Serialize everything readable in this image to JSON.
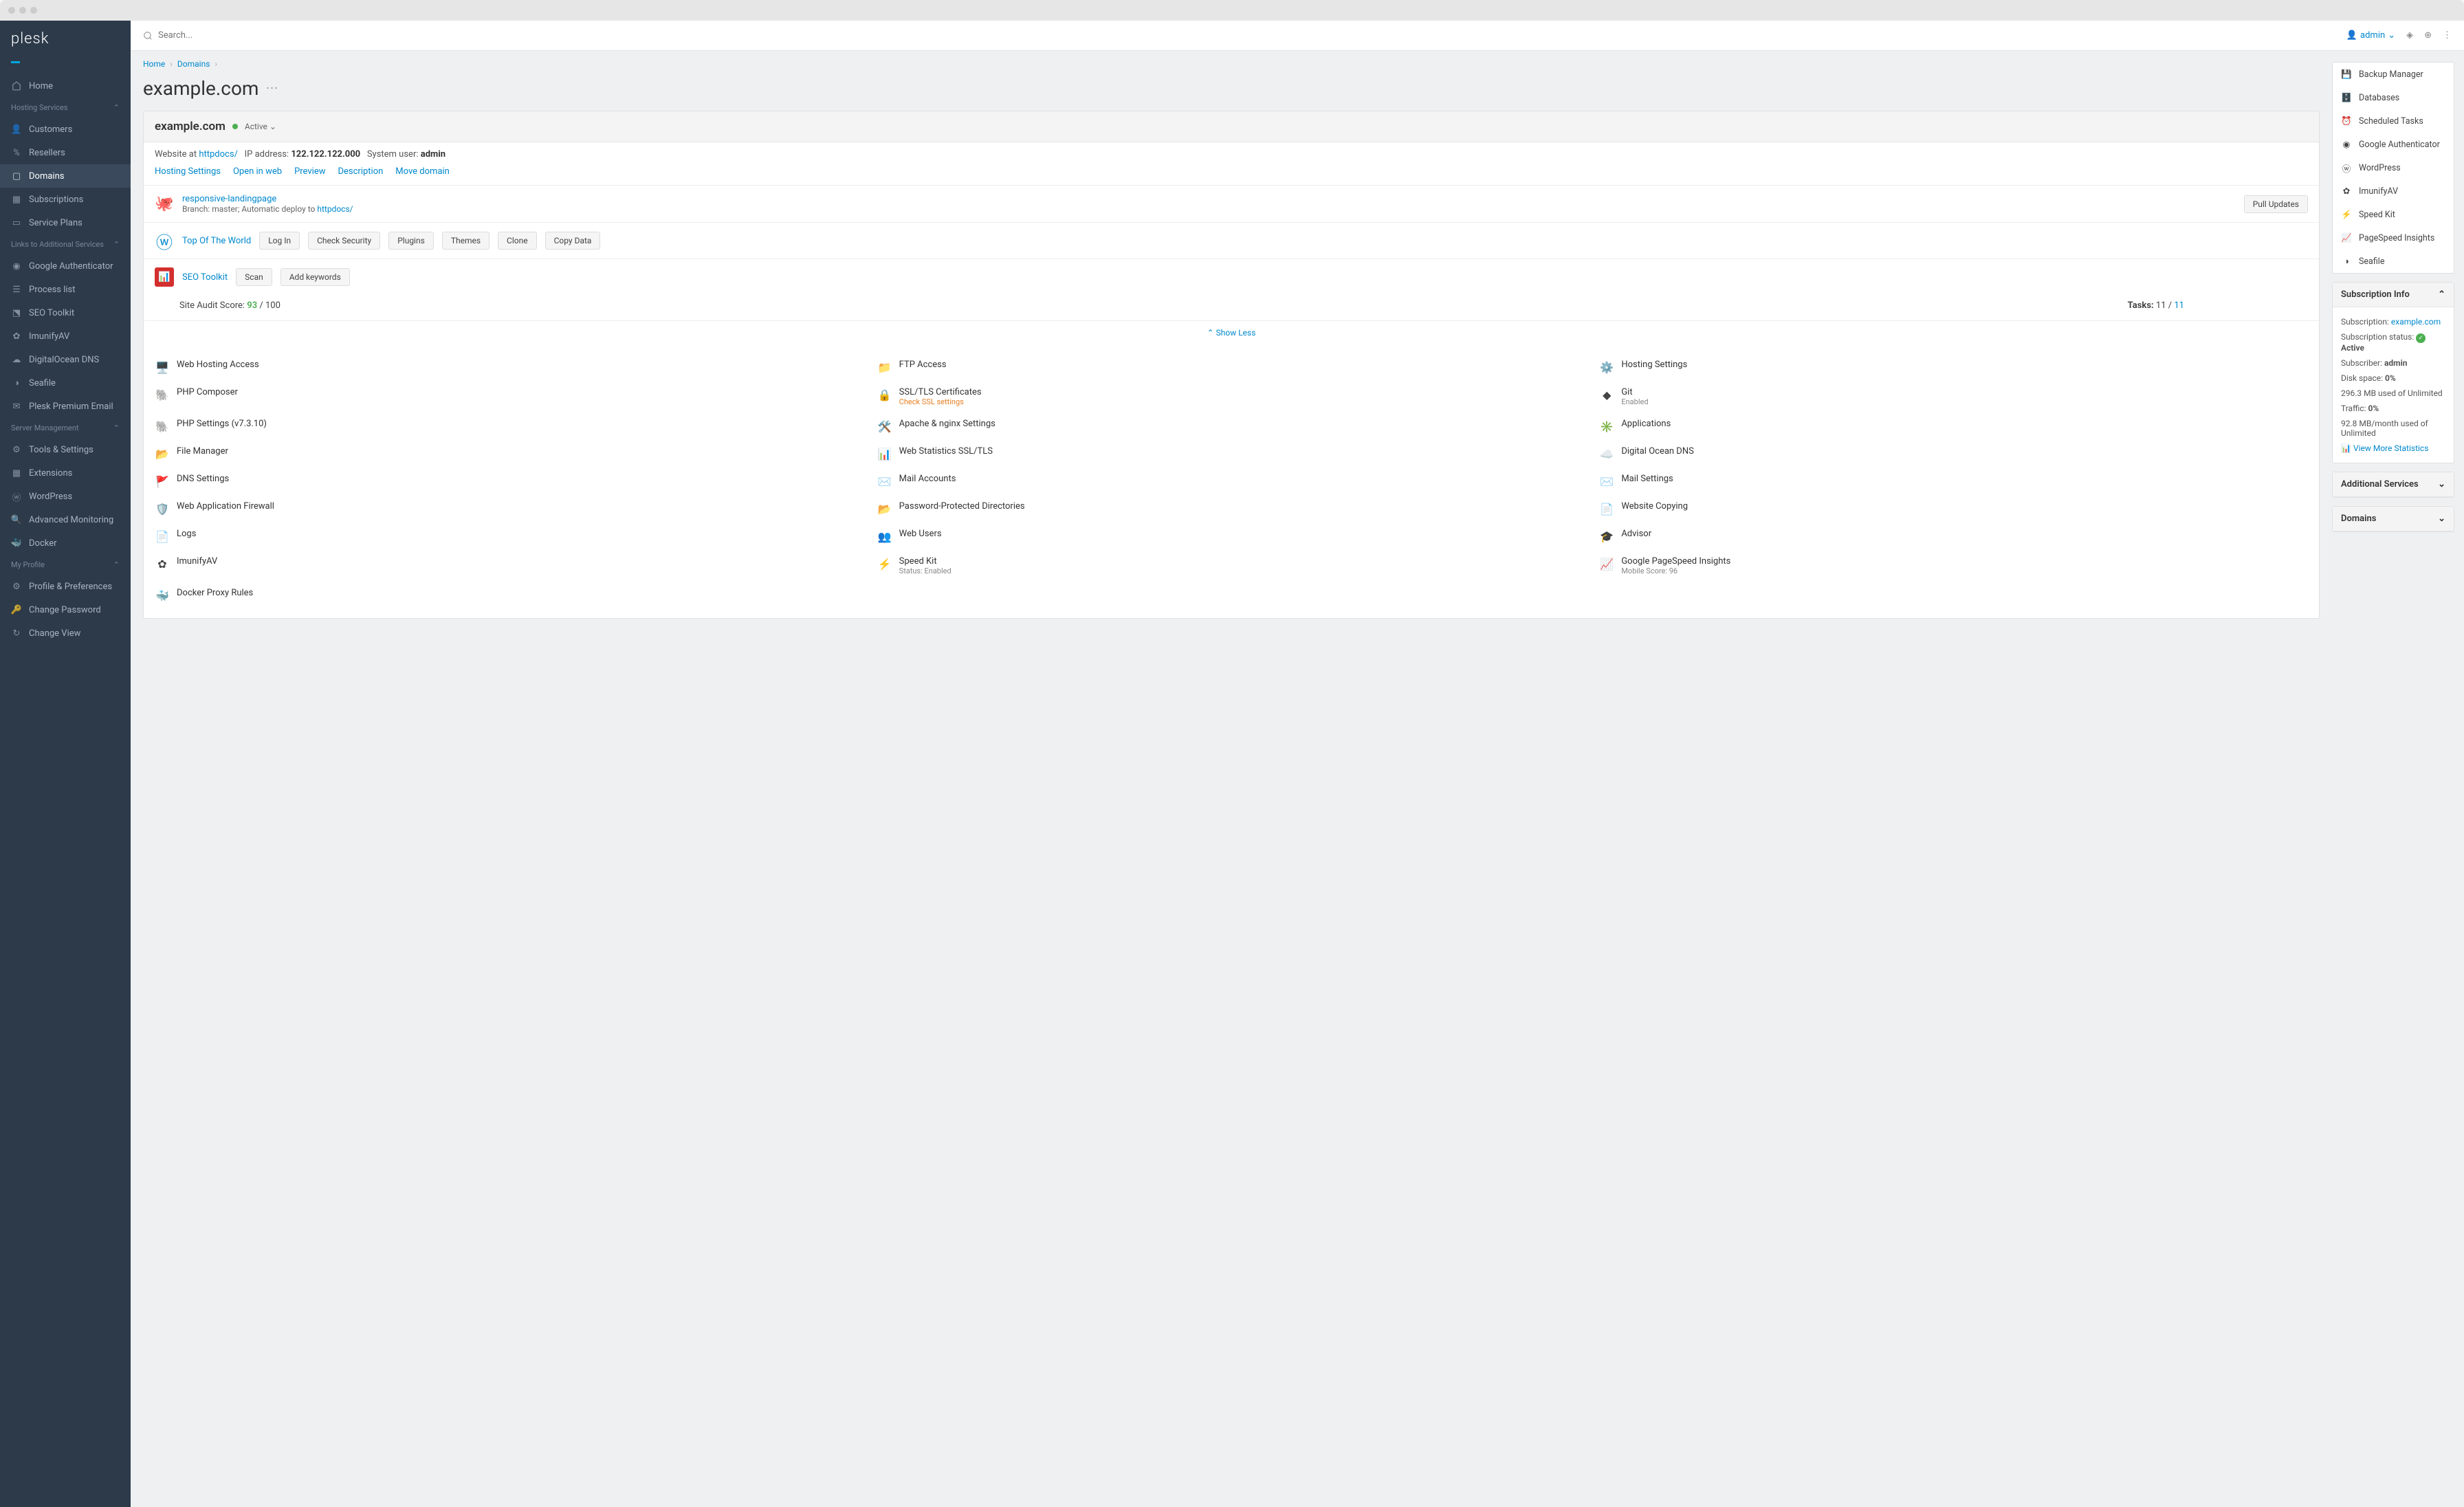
{
  "logo": "plesk",
  "sidebar": {
    "home": "Home",
    "sections": {
      "hosting": "Hosting Services",
      "links": "Links to Additional Services",
      "server": "Server Management",
      "profile": "My Profile"
    },
    "hosting_items": [
      "Customers",
      "Resellers",
      "Domains",
      "Subscriptions",
      "Service Plans"
    ],
    "links_items": [
      "Google Authenticator",
      "Process list",
      "SEO Toolkit",
      "ImunifyAV",
      "DigitalOcean DNS",
      "Seafile",
      "Plesk Premium Email"
    ],
    "server_items": [
      "Tools & Settings",
      "Extensions",
      "WordPress",
      "Advanced Monitoring",
      "Docker"
    ],
    "profile_items": [
      "Profile & Preferences",
      "Change Password",
      "Change View"
    ]
  },
  "search": {
    "placeholder": "Search..."
  },
  "user": {
    "name": "admin"
  },
  "breadcrumb": [
    "Home",
    "Domains"
  ],
  "page_title": "example.com",
  "domain_card": {
    "title": "example.com",
    "status": "Active",
    "website_at_label": "Website at",
    "website_at": "httpdocs/",
    "ip_label": "IP address:",
    "ip": "122.122.122.000",
    "sys_user_label": "System user:",
    "sys_user": "admin",
    "links": [
      "Hosting Settings",
      "Open in web",
      "Preview",
      "Description",
      "Move domain"
    ]
  },
  "git": {
    "repo": "responsive-landingpage",
    "branch_line": "Branch: master; Automatic deploy to ",
    "deploy_target": "httpdocs/",
    "pull_btn": "Pull Updates"
  },
  "wordpress": {
    "title": "Top Of The World",
    "buttons": [
      "Log In",
      "Check Security",
      "Plugins",
      "Themes",
      "Clone",
      "Copy Data"
    ]
  },
  "seo": {
    "title": "SEO Toolkit",
    "buttons": [
      "Scan",
      "Add keywords"
    ],
    "audit_label": "Site Audit Score:",
    "audit_score": "93",
    "audit_of": "/ 100",
    "tasks_label": "Tasks:",
    "tasks_done": "11",
    "tasks_sep": "/",
    "tasks_total": "11"
  },
  "show_less": "Show Less",
  "tools": [
    {
      "label": "Web Hosting Access"
    },
    {
      "label": "FTP Access"
    },
    {
      "label": "Hosting Settings"
    },
    {
      "label": "PHP Composer"
    },
    {
      "label": "SSL/TLS Certificates",
      "sub": "Check SSL settings",
      "warn": true
    },
    {
      "label": "Git",
      "sub": "Enabled"
    },
    {
      "label": "PHP Settings (v7.3.10)"
    },
    {
      "label": "Apache & nginx Settings"
    },
    {
      "label": "Applications"
    },
    {
      "label": "File Manager"
    },
    {
      "label": "Web Statistics SSL/TLS"
    },
    {
      "label": "Digital Ocean DNS"
    },
    {
      "label": "DNS Settings"
    },
    {
      "label": "Mail Accounts"
    },
    {
      "label": "Mail Settings"
    },
    {
      "label": "Web Application Firewall"
    },
    {
      "label": "Password-Protected Directories"
    },
    {
      "label": "Website Copying"
    },
    {
      "label": "Logs"
    },
    {
      "label": "Web Users"
    },
    {
      "label": "Advisor"
    },
    {
      "label": "ImunifyAV"
    },
    {
      "label": "Speed Kit",
      "sub": "Status: Enabled"
    },
    {
      "label": "Google PageSpeed Insights",
      "sub": "Mobile Score: 96"
    },
    {
      "label": "Docker Proxy Rules"
    }
  ],
  "right_tools": [
    "Backup Manager",
    "Databases",
    "Scheduled Tasks",
    "Google Authenticator",
    "WordPress",
    "ImunifyAV",
    "Speed Kit",
    "PageSpeed Insights",
    "Seafile"
  ],
  "subscription": {
    "header": "Subscription Info",
    "sub_label": "Subscription:",
    "sub_value": "example.com",
    "status_label": "Subscription status:",
    "status_value": "Active",
    "subscriber_label": "Subscriber:",
    "subscriber_value": "admin",
    "disk_label": "Disk space:",
    "disk_value": "0%",
    "disk_detail": "296.3 MB used of Unlimited",
    "traffic_label": "Traffic:",
    "traffic_value": "0%",
    "traffic_detail": "92.8 MB/month used of Unlimited",
    "more_stats": "View More Statistics"
  },
  "additional_services_header": "Additional Services",
  "domains_header": "Domains"
}
